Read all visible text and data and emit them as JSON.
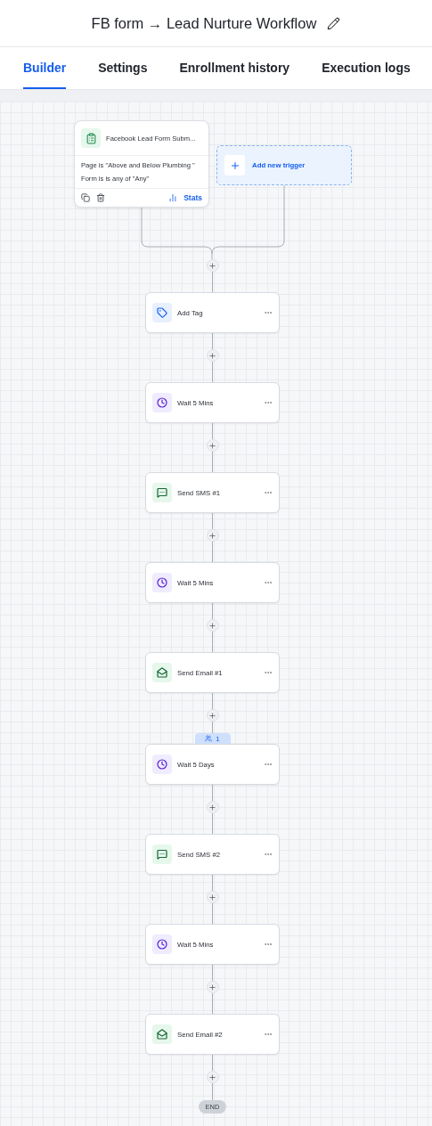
{
  "title": "FB form → Lead Nurture Workflow",
  "tabs": [
    {
      "label": "Builder",
      "selected": true
    },
    {
      "label": "Settings",
      "selected": false
    },
    {
      "label": "Enrollment history",
      "selected": false
    },
    {
      "label": "Execution logs",
      "selected": false
    }
  ],
  "trigger": {
    "title": "Facebook Lead Form Subm...",
    "conditions": [
      "Page is \"Above and Below Plumbing \"",
      "Form is is any of \"Any\""
    ],
    "stats": "Stats"
  },
  "add_trigger": "Add new trigger",
  "steps": [
    {
      "kind": "tag",
      "label": "Add Tag"
    },
    {
      "kind": "wait",
      "label": "Wait 5 Mins"
    },
    {
      "kind": "sms",
      "label": "Send SMS #1"
    },
    {
      "kind": "wait",
      "label": "Wait 5 Mins"
    },
    {
      "kind": "email",
      "label": "Send Email #1"
    },
    {
      "kind": "wait",
      "label": "Wait 5 Days",
      "badge": "1"
    },
    {
      "kind": "sms",
      "label": "Send SMS #2"
    },
    {
      "kind": "wait",
      "label": "Wait 5 Mins"
    },
    {
      "kind": "email",
      "label": "Send Email #2"
    }
  ],
  "end": "END"
}
